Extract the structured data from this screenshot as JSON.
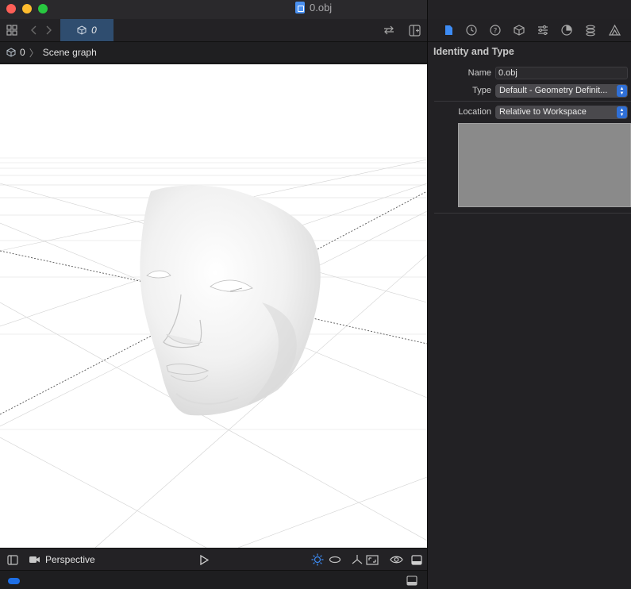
{
  "window": {
    "title": "0.obj"
  },
  "tabbar": {
    "active_tab": "0"
  },
  "breadcrumb": {
    "root": "0",
    "current": "Scene graph"
  },
  "bottombar": {
    "camera_label": "Perspective"
  },
  "inspector": {
    "section_title": "Identity and Type",
    "name_label": "Name",
    "name_value": "0.obj",
    "type_label": "Type",
    "type_value": "Default - Geometry Definit...",
    "location_label": "Location",
    "location_value": "Relative to Workspace"
  },
  "colors": {
    "accent": "#3d8cf5",
    "active_tab_bg": "#2f4d6f",
    "viewport_bg": "#ffffff"
  },
  "icons": {
    "inspector_tabs": [
      "file-icon",
      "history-icon",
      "help-icon",
      "cube-icon",
      "sliders-icon",
      "physics-icon",
      "spring-icon",
      "shape-icon"
    ]
  }
}
